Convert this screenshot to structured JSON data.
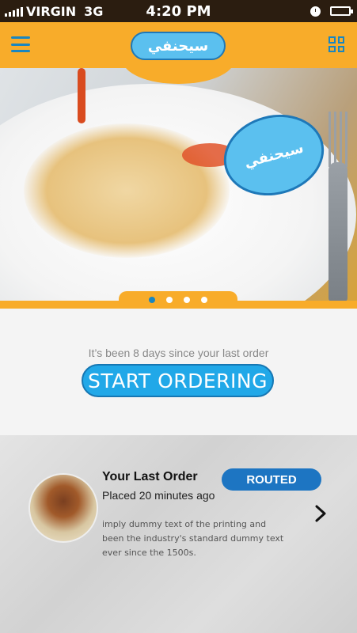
{
  "status_bar": {
    "carrier": "VIRGIN",
    "network": "3G",
    "time": "4:20 PM"
  },
  "header": {
    "logo_text": "سيحنفي",
    "menu_icon": "hamburger-icon",
    "grid_icon": "qr-grid-icon"
  },
  "hero": {
    "stamp_text": "سيحنفي",
    "carousel": {
      "count": 4,
      "active_index": 0
    }
  },
  "order_prompt": {
    "message": "It’s been 8 days since your last order",
    "button_label": "START ORDERING"
  },
  "last_order": {
    "title": "Your Last Order",
    "placed": "Placed 20 minutes ago",
    "status": "ROUTED",
    "description": "imply dummy text of the printing and been the industry's standard dummy text ever since the 1500s."
  },
  "colors": {
    "brand_orange": "#f8ac2a",
    "brand_blue": "#21a8e8",
    "badge_blue": "#1d75c2",
    "status_bg": "#2b1d10"
  }
}
